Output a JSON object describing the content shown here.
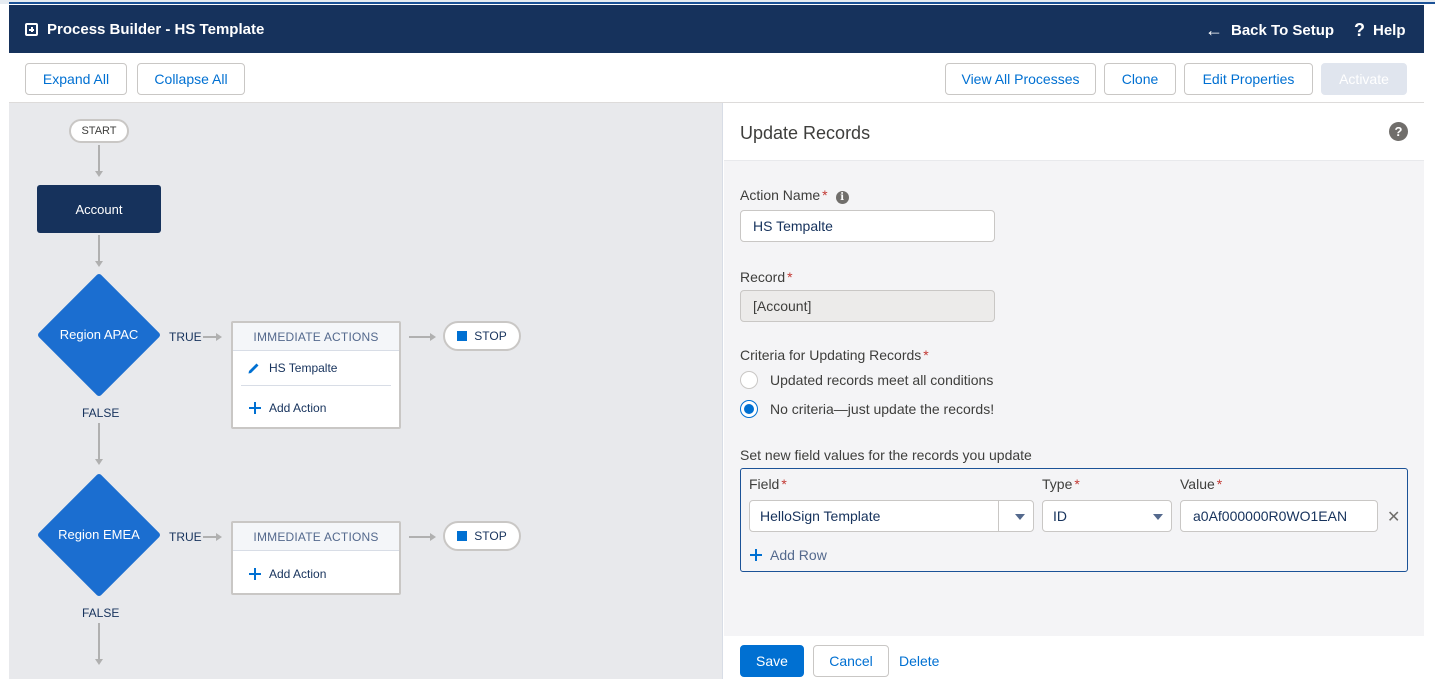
{
  "header": {
    "title": "Process Builder - HS Template",
    "back_label": "Back To Setup",
    "help_label": "Help"
  },
  "toolbar": {
    "expand_all": "Expand All",
    "collapse_all": "Collapse All",
    "view_all_processes": "View All Processes",
    "clone": "Clone",
    "edit_properties": "Edit Properties",
    "activate": "Activate"
  },
  "canvas": {
    "start": "START",
    "object_node": "Account",
    "criteria": [
      {
        "label": "Region APAC",
        "true_label": "TRUE",
        "false_label": "FALSE",
        "actions_header": "IMMEDIATE ACTIONS",
        "actions": [
          "HS Tempalte"
        ],
        "add_action": "Add Action",
        "stop": "STOP"
      },
      {
        "label": "Region EMEA",
        "true_label": "TRUE",
        "false_label": "FALSE",
        "actions_header": "IMMEDIATE ACTIONS",
        "actions": [],
        "add_action": "Add Action",
        "stop": "STOP"
      }
    ]
  },
  "panel": {
    "title": "Update Records",
    "action_name_label": "Action Name",
    "action_name_value": "HS Tempalte",
    "record_label": "Record",
    "record_value": "[Account]",
    "criteria_label": "Criteria for Updating Records",
    "criteria_options": [
      {
        "label": "Updated records meet all conditions",
        "selected": false
      },
      {
        "label": "No criteria—just update the records!",
        "selected": true
      }
    ],
    "field_values_label": "Set new field values for the records you update",
    "columns": {
      "field": "Field",
      "type": "Type",
      "value": "Value"
    },
    "rows": [
      {
        "field": "HelloSign Template",
        "type": "ID",
        "value": "a0Af000000R0WO1EAN"
      }
    ],
    "add_row": "Add Row",
    "required_mark": "*",
    "info_glyph": "i",
    "help_glyph": "?",
    "remove_glyph": "✕"
  },
  "footer": {
    "save": "Save",
    "cancel": "Cancel",
    "delete": "Delete"
  },
  "icons": {
    "back": "←",
    "help": "?"
  },
  "colors": {
    "header_bg": "#16325c",
    "brand_blue": "#0070d2",
    "diamond": "#1b6ed0",
    "required": "#c23934"
  }
}
